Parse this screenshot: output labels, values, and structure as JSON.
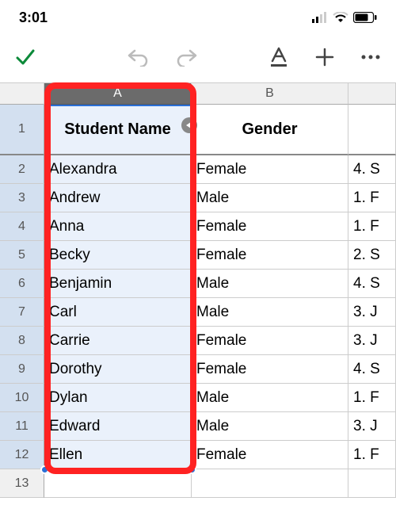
{
  "status": {
    "time": "3:01"
  },
  "columns": {
    "A": "A",
    "B": "B"
  },
  "header_row": {
    "A": "Student Name",
    "B": "Gender"
  },
  "rows": [
    {
      "n": "1"
    },
    {
      "n": "2",
      "A": "Alexandra",
      "B": "Female",
      "C": "4. S"
    },
    {
      "n": "3",
      "A": "Andrew",
      "B": "Male",
      "C": "1. F"
    },
    {
      "n": "4",
      "A": "Anna",
      "B": "Female",
      "C": "1. F"
    },
    {
      "n": "5",
      "A": "Becky",
      "B": "Female",
      "C": "2. S"
    },
    {
      "n": "6",
      "A": "Benjamin",
      "B": "Male",
      "C": "4. S"
    },
    {
      "n": "7",
      "A": "Carl",
      "B": "Male",
      "C": "3. J"
    },
    {
      "n": "8",
      "A": "Carrie",
      "B": "Female",
      "C": "3. J"
    },
    {
      "n": "9",
      "A": "Dorothy",
      "B": "Female",
      "C": "4. S"
    },
    {
      "n": "10",
      "A": "Dylan",
      "B": "Male",
      "C": "1. F"
    },
    {
      "n": "11",
      "A": "Edward",
      "B": "Male",
      "C": "3. J"
    },
    {
      "n": "12",
      "A": "Ellen",
      "B": "Female",
      "C": "1. F"
    },
    {
      "n": "13"
    }
  ]
}
